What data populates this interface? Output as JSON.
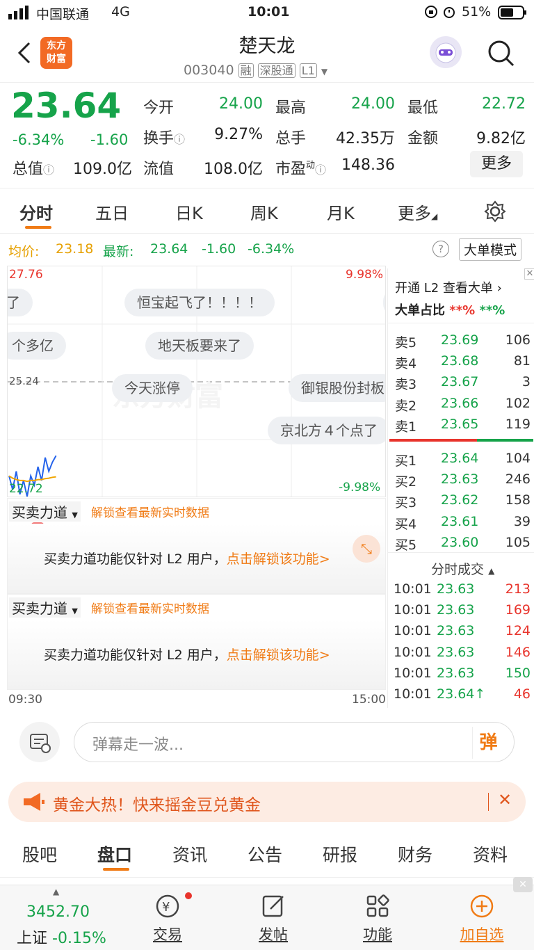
{
  "status_bar": {
    "carrier": "中国联通",
    "network": "4G",
    "time": "10:01",
    "battery": "51%"
  },
  "header": {
    "title": "楚天龙",
    "code": "003040",
    "badges": [
      "融",
      "深股通",
      "L1"
    ],
    "logo_text": [
      "东方",
      "财富"
    ]
  },
  "quote": {
    "price": "23.64",
    "change_pct": "-6.34%",
    "change": "-1.60",
    "open_label": "今开",
    "open": "24.00",
    "high_label": "最高",
    "high": "24.00",
    "low_label": "最低",
    "low": "22.72",
    "turnover_label": "换手",
    "turnover": "9.27%",
    "volume_label": "总手",
    "volume": "42.35万",
    "amount_label": "金额",
    "amount": "9.82亿",
    "mktcap_label": "总值",
    "mktcap": "109.0亿",
    "float_label": "流值",
    "float": "108.0亿",
    "pe_label": "市盈",
    "pe_sup": "动",
    "pe": "148.36",
    "more_button": "更多"
  },
  "tabs": [
    "分时",
    "五日",
    "日K",
    "周K",
    "月K",
    "更多"
  ],
  "avg_line": {
    "avg_label": "均价:",
    "avg": "23.18",
    "latest_label": "最新:",
    "latest": "23.64",
    "chg": "-1.60",
    "pct": "-6.34%",
    "big_order_button": "大单模式"
  },
  "chart": {
    "top_price": "27.76",
    "top_pct": "9.98%",
    "ref_price": "25.24",
    "bottom_price": "22.72",
    "bottom_pct": "-9.98%",
    "start_time": "09:30",
    "end_time": "15:00",
    "danmu": [
      "了",
      "恒宝起飞了！！！！",
      "个多亿",
      "地天板要来了",
      "今天涨停",
      "御银股份封板",
      "京北方４个点了"
    ]
  },
  "chart_data": {
    "type": "line",
    "ylim": [
      22.72,
      27.76
    ],
    "series": [
      {
        "name": "price",
        "values": [
          23.2,
          22.9,
          23.3,
          22.8,
          23.1,
          22.75,
          23.2,
          23.0,
          23.4,
          23.1,
          23.6,
          23.3,
          23.5,
          23.64
        ]
      },
      {
        "name": "avg",
        "values": [
          23.2,
          23.15,
          23.12,
          23.1,
          23.1,
          23.08,
          23.1,
          23.1,
          23.12,
          23.12,
          23.14,
          23.15,
          23.17,
          23.18
        ]
      }
    ]
  },
  "panels": [
    {
      "title": "买卖力道",
      "unlock": "解锁查看最新实时数据",
      "message": "买卖力道功能仅针对 L2 用户，",
      "link": "点击解锁该功能>"
    },
    {
      "title": "买卖力道",
      "unlock": "解锁查看最新实时数据",
      "message": "买卖力道功能仅针对 L2 用户，",
      "link": "点击解锁该功能>"
    }
  ],
  "orderbook": {
    "l2_link": "开通 L2 查看大单",
    "ratio_label": "大单占比",
    "ratio_red": "**%",
    "ratio_green": "**%",
    "sell": [
      {
        "label": "卖5",
        "price": "23.69",
        "vol": "106"
      },
      {
        "label": "卖4",
        "price": "23.68",
        "vol": "81"
      },
      {
        "label": "卖3",
        "price": "23.67",
        "vol": "3"
      },
      {
        "label": "卖2",
        "price": "23.66",
        "vol": "102"
      },
      {
        "label": "卖1",
        "price": "23.65",
        "vol": "119"
      }
    ],
    "buy": [
      {
        "label": "买1",
        "price": "23.64",
        "vol": "104"
      },
      {
        "label": "买2",
        "price": "23.63",
        "vol": "246"
      },
      {
        "label": "买3",
        "price": "23.62",
        "vol": "158"
      },
      {
        "label": "买4",
        "price": "23.61",
        "vol": "39"
      },
      {
        "label": "买5",
        "price": "23.60",
        "vol": "105"
      }
    ],
    "trades_title": "分时成交",
    "trades": [
      {
        "time": "10:01",
        "price": "23.63",
        "vol": "213"
      },
      {
        "time": "10:01",
        "price": "23.63",
        "vol": "169"
      },
      {
        "time": "10:01",
        "price": "23.63",
        "vol": "124"
      },
      {
        "time": "10:01",
        "price": "23.63",
        "vol": "146"
      },
      {
        "time": "10:01",
        "price": "23.63",
        "vol": "150"
      },
      {
        "time": "10:01",
        "price": "23.64↑",
        "vol": "46"
      }
    ]
  },
  "comment": {
    "placeholder": "弹幕走一波...",
    "send_label": "弹"
  },
  "banner": {
    "text": "黄金大热！快来摇金豆兑黄金"
  },
  "bottom_tabs": [
    "股吧",
    "盘口",
    "资讯",
    "公告",
    "研报",
    "财务",
    "资料"
  ],
  "footer": {
    "index_value": "3452.70",
    "index_name": "上证",
    "index_pct": "-0.15%",
    "items": [
      "交易",
      "发帖",
      "功能",
      "加自选"
    ]
  },
  "colors": {
    "red": "#e8342c",
    "green": "#16a34a",
    "orange": "#f07b15"
  }
}
